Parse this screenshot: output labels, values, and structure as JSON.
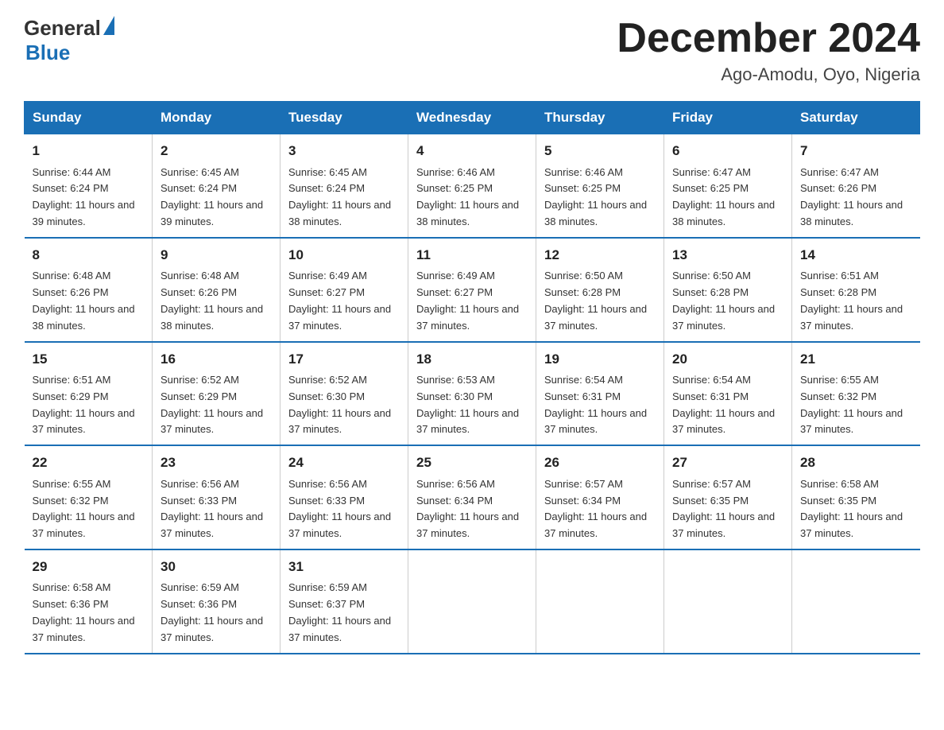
{
  "header": {
    "title": "December 2024",
    "location": "Ago-Amodu, Oyo, Nigeria",
    "logo_general": "General",
    "logo_blue": "Blue"
  },
  "calendar": {
    "weekdays": [
      "Sunday",
      "Monday",
      "Tuesday",
      "Wednesday",
      "Thursday",
      "Friday",
      "Saturday"
    ],
    "weeks": [
      [
        {
          "day": "1",
          "sunrise": "6:44 AM",
          "sunset": "6:24 PM",
          "daylight": "11 hours and 39 minutes."
        },
        {
          "day": "2",
          "sunrise": "6:45 AM",
          "sunset": "6:24 PM",
          "daylight": "11 hours and 39 minutes."
        },
        {
          "day": "3",
          "sunrise": "6:45 AM",
          "sunset": "6:24 PM",
          "daylight": "11 hours and 38 minutes."
        },
        {
          "day": "4",
          "sunrise": "6:46 AM",
          "sunset": "6:25 PM",
          "daylight": "11 hours and 38 minutes."
        },
        {
          "day": "5",
          "sunrise": "6:46 AM",
          "sunset": "6:25 PM",
          "daylight": "11 hours and 38 minutes."
        },
        {
          "day": "6",
          "sunrise": "6:47 AM",
          "sunset": "6:25 PM",
          "daylight": "11 hours and 38 minutes."
        },
        {
          "day": "7",
          "sunrise": "6:47 AM",
          "sunset": "6:26 PM",
          "daylight": "11 hours and 38 minutes."
        }
      ],
      [
        {
          "day": "8",
          "sunrise": "6:48 AM",
          "sunset": "6:26 PM",
          "daylight": "11 hours and 38 minutes."
        },
        {
          "day": "9",
          "sunrise": "6:48 AM",
          "sunset": "6:26 PM",
          "daylight": "11 hours and 38 minutes."
        },
        {
          "day": "10",
          "sunrise": "6:49 AM",
          "sunset": "6:27 PM",
          "daylight": "11 hours and 37 minutes."
        },
        {
          "day": "11",
          "sunrise": "6:49 AM",
          "sunset": "6:27 PM",
          "daylight": "11 hours and 37 minutes."
        },
        {
          "day": "12",
          "sunrise": "6:50 AM",
          "sunset": "6:28 PM",
          "daylight": "11 hours and 37 minutes."
        },
        {
          "day": "13",
          "sunrise": "6:50 AM",
          "sunset": "6:28 PM",
          "daylight": "11 hours and 37 minutes."
        },
        {
          "day": "14",
          "sunrise": "6:51 AM",
          "sunset": "6:28 PM",
          "daylight": "11 hours and 37 minutes."
        }
      ],
      [
        {
          "day": "15",
          "sunrise": "6:51 AM",
          "sunset": "6:29 PM",
          "daylight": "11 hours and 37 minutes."
        },
        {
          "day": "16",
          "sunrise": "6:52 AM",
          "sunset": "6:29 PM",
          "daylight": "11 hours and 37 minutes."
        },
        {
          "day": "17",
          "sunrise": "6:52 AM",
          "sunset": "6:30 PM",
          "daylight": "11 hours and 37 minutes."
        },
        {
          "day": "18",
          "sunrise": "6:53 AM",
          "sunset": "6:30 PM",
          "daylight": "11 hours and 37 minutes."
        },
        {
          "day": "19",
          "sunrise": "6:54 AM",
          "sunset": "6:31 PM",
          "daylight": "11 hours and 37 minutes."
        },
        {
          "day": "20",
          "sunrise": "6:54 AM",
          "sunset": "6:31 PM",
          "daylight": "11 hours and 37 minutes."
        },
        {
          "day": "21",
          "sunrise": "6:55 AM",
          "sunset": "6:32 PM",
          "daylight": "11 hours and 37 minutes."
        }
      ],
      [
        {
          "day": "22",
          "sunrise": "6:55 AM",
          "sunset": "6:32 PM",
          "daylight": "11 hours and 37 minutes."
        },
        {
          "day": "23",
          "sunrise": "6:56 AM",
          "sunset": "6:33 PM",
          "daylight": "11 hours and 37 minutes."
        },
        {
          "day": "24",
          "sunrise": "6:56 AM",
          "sunset": "6:33 PM",
          "daylight": "11 hours and 37 minutes."
        },
        {
          "day": "25",
          "sunrise": "6:56 AM",
          "sunset": "6:34 PM",
          "daylight": "11 hours and 37 minutes."
        },
        {
          "day": "26",
          "sunrise": "6:57 AM",
          "sunset": "6:34 PM",
          "daylight": "11 hours and 37 minutes."
        },
        {
          "day": "27",
          "sunrise": "6:57 AM",
          "sunset": "6:35 PM",
          "daylight": "11 hours and 37 minutes."
        },
        {
          "day": "28",
          "sunrise": "6:58 AM",
          "sunset": "6:35 PM",
          "daylight": "11 hours and 37 minutes."
        }
      ],
      [
        {
          "day": "29",
          "sunrise": "6:58 AM",
          "sunset": "6:36 PM",
          "daylight": "11 hours and 37 minutes."
        },
        {
          "day": "30",
          "sunrise": "6:59 AM",
          "sunset": "6:36 PM",
          "daylight": "11 hours and 37 minutes."
        },
        {
          "day": "31",
          "sunrise": "6:59 AM",
          "sunset": "6:37 PM",
          "daylight": "11 hours and 37 minutes."
        },
        null,
        null,
        null,
        null
      ]
    ]
  }
}
